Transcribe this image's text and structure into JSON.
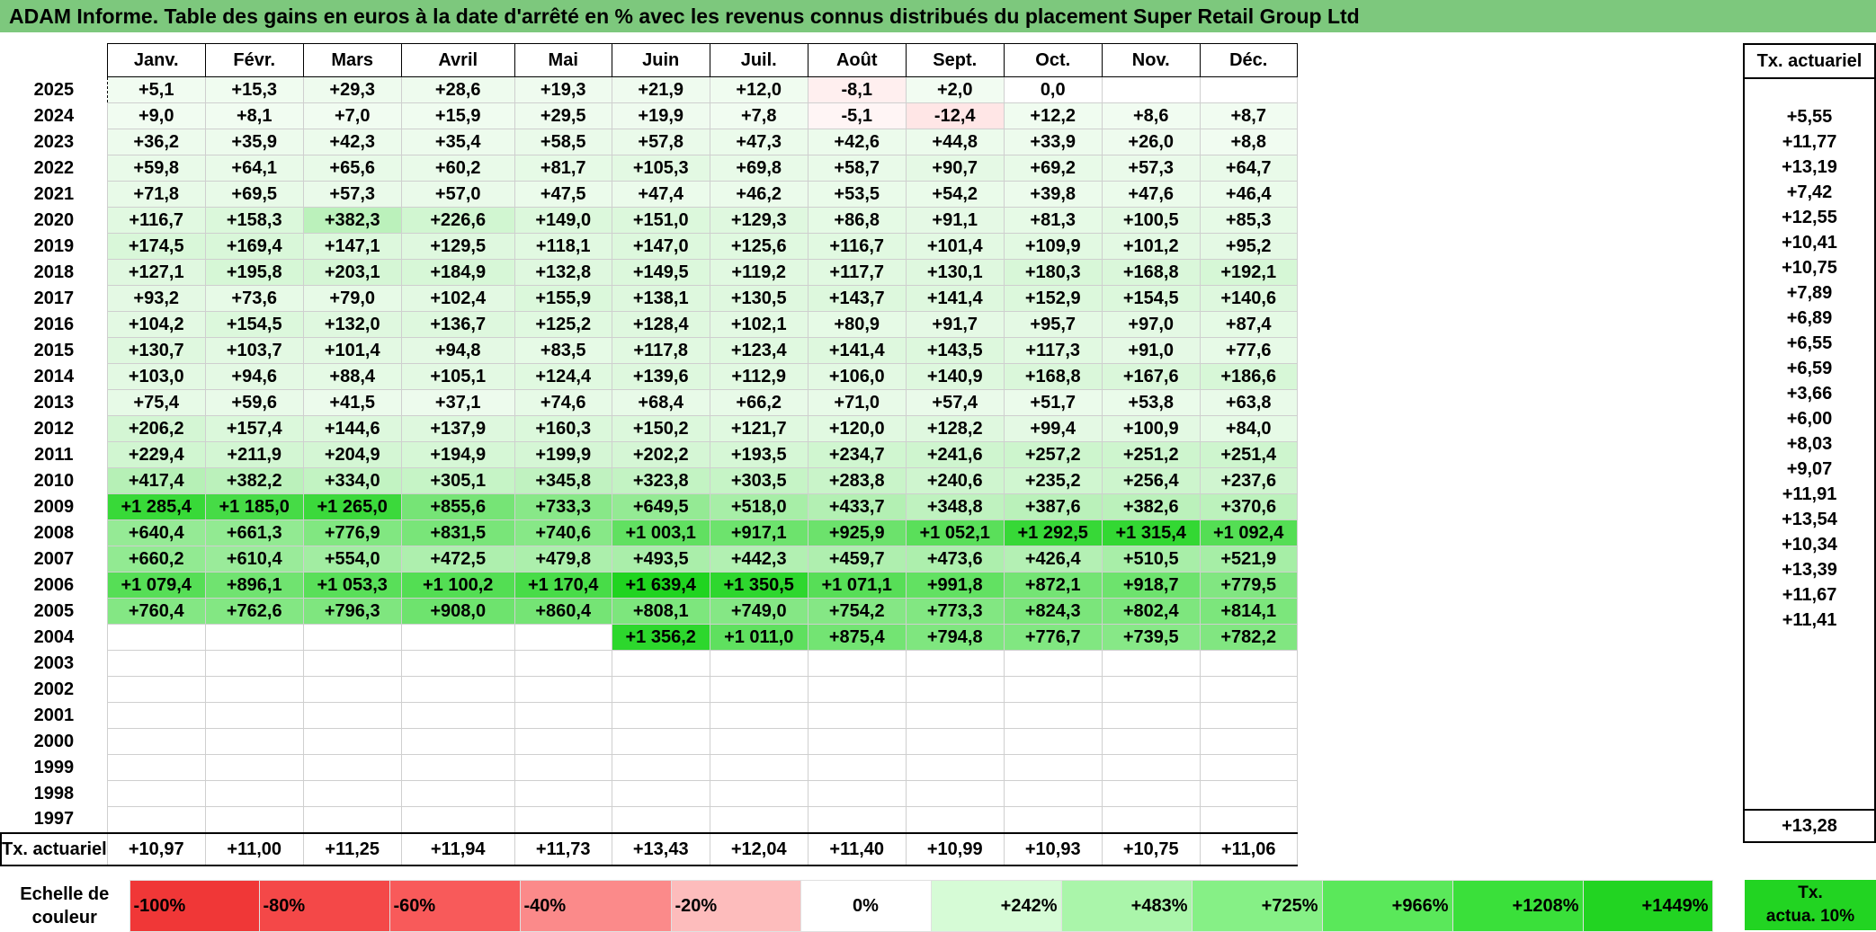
{
  "title": "ADAM Informe. Table des gains en euros à la date d'arrêté en % avec les revenus connus distribués du placement Super Retail Group Ltd",
  "months": [
    "Janv.",
    "Févr.",
    "Mars",
    "Avril",
    "Mai",
    "Juin",
    "Juil.",
    "Août",
    "Sept.",
    "Oct.",
    "Nov.",
    "Déc."
  ],
  "side_header": "Tx. actuariel",
  "rows": [
    {
      "year": "2025",
      "values": [
        "+5,1",
        "+15,3",
        "+29,3",
        "+28,6",
        "+19,3",
        "+21,9",
        "+12,0",
        "-8,1",
        "+2,0",
        "0,0",
        "",
        ""
      ],
      "rate": ""
    },
    {
      "year": "2024",
      "values": [
        "+9,0",
        "+8,1",
        "+7,0",
        "+15,9",
        "+29,5",
        "+19,9",
        "+7,8",
        "-5,1",
        "-12,4",
        "+12,2",
        "+8,6",
        "+8,7"
      ],
      "rate": "+5,55"
    },
    {
      "year": "2023",
      "values": [
        "+36,2",
        "+35,9",
        "+42,3",
        "+35,4",
        "+58,5",
        "+57,8",
        "+47,3",
        "+42,6",
        "+44,8",
        "+33,9",
        "+26,0",
        "+8,8"
      ],
      "rate": "+11,77"
    },
    {
      "year": "2022",
      "values": [
        "+59,8",
        "+64,1",
        "+65,6",
        "+60,2",
        "+81,7",
        "+105,3",
        "+69,8",
        "+58,7",
        "+90,7",
        "+69,2",
        "+57,3",
        "+64,7"
      ],
      "rate": "+13,19"
    },
    {
      "year": "2021",
      "values": [
        "+71,8",
        "+69,5",
        "+57,3",
        "+57,0",
        "+47,5",
        "+47,4",
        "+46,2",
        "+53,5",
        "+54,2",
        "+39,8",
        "+47,6",
        "+46,4"
      ],
      "rate": "+7,42"
    },
    {
      "year": "2020",
      "values": [
        "+116,7",
        "+158,3",
        "+382,3",
        "+226,6",
        "+149,0",
        "+151,0",
        "+129,3",
        "+86,8",
        "+91,1",
        "+81,3",
        "+100,5",
        "+85,3"
      ],
      "rate": "+12,55"
    },
    {
      "year": "2019",
      "values": [
        "+174,5",
        "+169,4",
        "+147,1",
        "+129,5",
        "+118,1",
        "+147,0",
        "+125,6",
        "+116,7",
        "+101,4",
        "+109,9",
        "+101,2",
        "+95,2"
      ],
      "rate": "+10,41"
    },
    {
      "year": "2018",
      "values": [
        "+127,1",
        "+195,8",
        "+203,1",
        "+184,9",
        "+132,8",
        "+149,5",
        "+119,2",
        "+117,7",
        "+130,1",
        "+180,3",
        "+168,8",
        "+192,1"
      ],
      "rate": "+10,75"
    },
    {
      "year": "2017",
      "values": [
        "+93,2",
        "+73,6",
        "+79,0",
        "+102,4",
        "+155,9",
        "+138,1",
        "+130,5",
        "+143,7",
        "+141,4",
        "+152,9",
        "+154,5",
        "+140,6"
      ],
      "rate": "+7,89"
    },
    {
      "year": "2016",
      "values": [
        "+104,2",
        "+154,5",
        "+132,0",
        "+136,7",
        "+125,2",
        "+128,4",
        "+102,1",
        "+80,9",
        "+91,7",
        "+95,7",
        "+97,0",
        "+87,4"
      ],
      "rate": "+6,89"
    },
    {
      "year": "2015",
      "values": [
        "+130,7",
        "+103,7",
        "+101,4",
        "+94,8",
        "+83,5",
        "+117,8",
        "+123,4",
        "+141,4",
        "+143,5",
        "+117,3",
        "+91,0",
        "+77,6"
      ],
      "rate": "+6,55"
    },
    {
      "year": "2014",
      "values": [
        "+103,0",
        "+94,6",
        "+88,4",
        "+105,1",
        "+124,4",
        "+139,6",
        "+112,9",
        "+106,0",
        "+140,9",
        "+168,8",
        "+167,6",
        "+186,6"
      ],
      "rate": "+6,59"
    },
    {
      "year": "2013",
      "values": [
        "+75,4",
        "+59,6",
        "+41,5",
        "+37,1",
        "+74,6",
        "+68,4",
        "+66,2",
        "+71,0",
        "+57,4",
        "+51,7",
        "+53,8",
        "+63,8"
      ],
      "rate": "+3,66"
    },
    {
      "year": "2012",
      "values": [
        "+206,2",
        "+157,4",
        "+144,6",
        "+137,9",
        "+160,3",
        "+150,2",
        "+121,7",
        "+120,0",
        "+128,2",
        "+99,4",
        "+100,9",
        "+84,0"
      ],
      "rate": "+6,00"
    },
    {
      "year": "2011",
      "values": [
        "+229,4",
        "+211,9",
        "+204,9",
        "+194,9",
        "+199,9",
        "+202,2",
        "+193,5",
        "+234,7",
        "+241,6",
        "+257,2",
        "+251,2",
        "+251,4"
      ],
      "rate": "+8,03"
    },
    {
      "year": "2010",
      "values": [
        "+417,4",
        "+382,2",
        "+334,0",
        "+305,1",
        "+345,8",
        "+323,8",
        "+303,5",
        "+283,8",
        "+240,6",
        "+235,2",
        "+256,4",
        "+237,6"
      ],
      "rate": "+9,07"
    },
    {
      "year": "2009",
      "values": [
        "+1 285,4",
        "+1 185,0",
        "+1 265,0",
        "+855,6",
        "+733,3",
        "+649,5",
        "+518,0",
        "+433,7",
        "+348,8",
        "+387,6",
        "+382,6",
        "+370,6"
      ],
      "rate": "+11,91"
    },
    {
      "year": "2008",
      "values": [
        "+640,4",
        "+661,3",
        "+776,9",
        "+831,5",
        "+740,6",
        "+1 003,1",
        "+917,1",
        "+925,9",
        "+1 052,1",
        "+1 292,5",
        "+1 315,4",
        "+1 092,4"
      ],
      "rate": "+13,54"
    },
    {
      "year": "2007",
      "values": [
        "+660,2",
        "+610,4",
        "+554,0",
        "+472,5",
        "+479,8",
        "+493,5",
        "+442,3",
        "+459,7",
        "+473,6",
        "+426,4",
        "+510,5",
        "+521,9"
      ],
      "rate": "+10,34"
    },
    {
      "year": "2006",
      "values": [
        "+1 079,4",
        "+896,1",
        "+1 053,3",
        "+1 100,2",
        "+1 170,4",
        "+1 639,4",
        "+1 350,5",
        "+1 071,1",
        "+991,8",
        "+872,1",
        "+918,7",
        "+779,5"
      ],
      "rate": "+13,39"
    },
    {
      "year": "2005",
      "values": [
        "+760,4",
        "+762,6",
        "+796,3",
        "+908,0",
        "+860,4",
        "+808,1",
        "+749,0",
        "+754,2",
        "+773,3",
        "+824,3",
        "+802,4",
        "+814,1"
      ],
      "rate": "+11,67"
    },
    {
      "year": "2004",
      "values": [
        "",
        "",
        "",
        "",
        "",
        "+1 356,2",
        "+1 011,0",
        "+875,4",
        "+794,8",
        "+776,7",
        "+739,5",
        "+782,2"
      ],
      "rate": "+11,41"
    },
    {
      "year": "2003",
      "values": [
        "",
        "",
        "",
        "",
        "",
        "",
        "",
        "",
        "",
        "",
        "",
        ""
      ],
      "rate": ""
    },
    {
      "year": "2002",
      "values": [
        "",
        "",
        "",
        "",
        "",
        "",
        "",
        "",
        "",
        "",
        "",
        ""
      ],
      "rate": ""
    },
    {
      "year": "2001",
      "values": [
        "",
        "",
        "",
        "",
        "",
        "",
        "",
        "",
        "",
        "",
        "",
        ""
      ],
      "rate": ""
    },
    {
      "year": "2000",
      "values": [
        "",
        "",
        "",
        "",
        "",
        "",
        "",
        "",
        "",
        "",
        "",
        ""
      ],
      "rate": ""
    },
    {
      "year": "1999",
      "values": [
        "",
        "",
        "",
        "",
        "",
        "",
        "",
        "",
        "",
        "",
        "",
        ""
      ],
      "rate": ""
    },
    {
      "year": "1998",
      "values": [
        "",
        "",
        "",
        "",
        "",
        "",
        "",
        "",
        "",
        "",
        "",
        ""
      ],
      "rate": ""
    },
    {
      "year": "1997",
      "values": [
        "",
        "",
        "",
        "",
        "",
        "",
        "",
        "",
        "",
        "",
        "",
        ""
      ],
      "rate": ""
    }
  ],
  "totals": {
    "label": "Tx. actuariel",
    "values": [
      "+10,97",
      "+11,00",
      "+11,25",
      "+11,94",
      "+11,73",
      "+13,43",
      "+12,04",
      "+11,40",
      "+10,99",
      "+10,93",
      "+10,75",
      "+11,06"
    ],
    "rate": "+13,28"
  },
  "legend": {
    "label_line1": "Echelle de",
    "label_line2": "couleur",
    "steps": [
      "-100%",
      "-80%",
      "-60%",
      "-40%",
      "-20%",
      "0%",
      "+242%",
      "+483%",
      "+725%",
      "+966%",
      "+1208%",
      "+1449%"
    ],
    "step_colors": [
      "#f03737",
      "#f44848",
      "#f85a5a",
      "#fb8a8a",
      "#fdbcbc",
      "#ffffff",
      "#d6fbd6",
      "#aaf5aa",
      "#86f086",
      "#5ae85a",
      "#3ae03a",
      "#22d422"
    ],
    "side_line1": "Tx.",
    "side_line2": "actua. 10%"
  }
}
